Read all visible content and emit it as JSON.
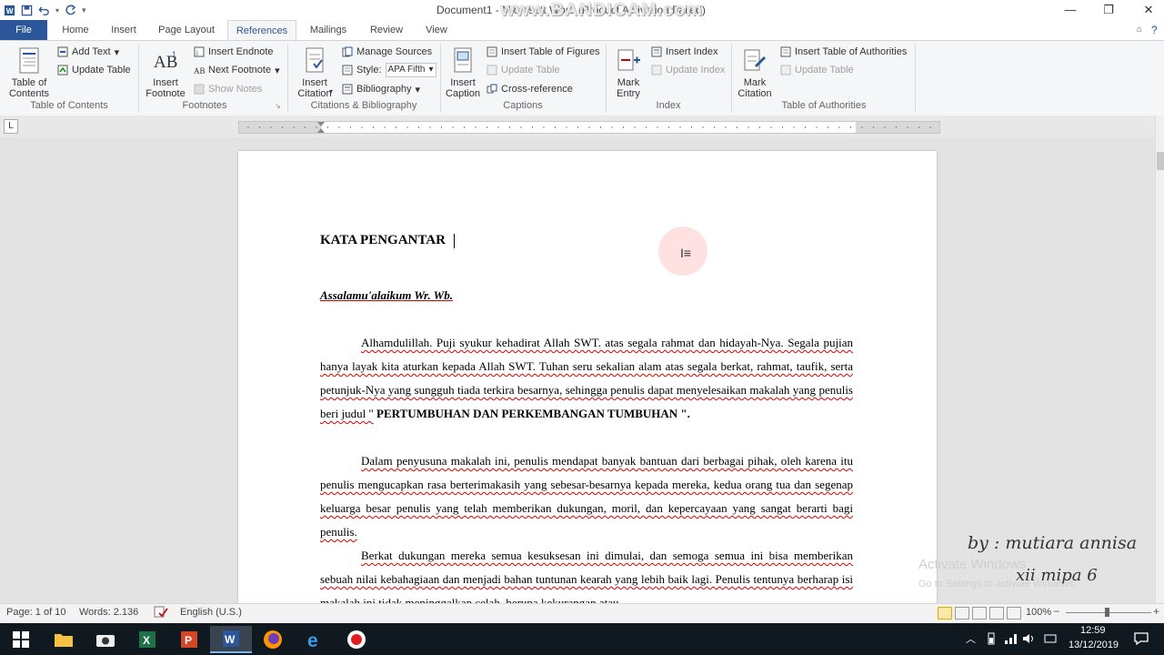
{
  "title_bar": {
    "document_title": "Document1 - Microsoft Word (Product Activation Failed)",
    "watermark": "www.BANDICAM.com",
    "minimize": "—",
    "restore": "❐",
    "close": "✕"
  },
  "tabs": [
    {
      "label": "File"
    },
    {
      "label": "Home"
    },
    {
      "label": "Insert"
    },
    {
      "label": "Page Layout"
    },
    {
      "label": "References"
    },
    {
      "label": "Mailings"
    },
    {
      "label": "Review"
    },
    {
      "label": "View"
    }
  ],
  "ribbon": {
    "toc": {
      "group": "Table of Contents",
      "big": "Table of\nContents",
      "add_text": "Add Text",
      "update_table": "Update Table"
    },
    "footnotes": {
      "group": "Footnotes",
      "big": "Insert\nFootnote",
      "insert_endnote": "Insert Endnote",
      "next_footnote": "Next Footnote",
      "show_notes": "Show Notes"
    },
    "citations": {
      "group": "Citations & Bibliography",
      "big": "Insert\nCitation",
      "manage_sources": "Manage Sources",
      "style_label": "Style:",
      "style_value": "APA Fifth",
      "bibliography": "Bibliography"
    },
    "captions": {
      "group": "Captions",
      "big": "Insert\nCaption",
      "insert_tof": "Insert Table of Figures",
      "update_table": "Update Table",
      "cross_reference": "Cross-reference"
    },
    "index": {
      "group": "Index",
      "big": "Mark\nEntry",
      "insert_index": "Insert Index",
      "update_index": "Update Index"
    },
    "toa": {
      "group": "Table of Authorities",
      "big": "Mark\nCitation",
      "insert_toa": "Insert Table of Authorities",
      "update_table": "Update Table"
    }
  },
  "document": {
    "heading": "KATA PENGANTAR",
    "greeting": "Assalamu'alaikum Wr. Wb.",
    "p1": "Alhamdulillah. Puji syukur kehadirat Allah SWT. atas segala rahmat dan hidayah-Nya. Segala pujian hanya layak kita aturkan kepada Allah SWT. Tuhan seru sekalian alam atas segala berkat, rahmat, taufik, serta petunjuk-Nya yang sungguh tiada terkira besarnya, sehingga penulis dapat menyelesaikan makalah yang penulis beri judul \"",
    "p1_bold": "PERTUMBUHAN DAN PERKEMBANGAN TUMBUHAN \".",
    "p2": "Dalam penyusuna makalah ini, penulis mendapat banyak bantuan dari berbagai pihak, oleh karena itu penulis mengucapkan rasa berterimakasih yang sebesar-besarnya kepada mereka, kedua orang tua dan segenap keluarga besar penulis yang telah memberikan dukungan, moril, dan kepercayaan yang sangat berarti bagi penulis.",
    "p3": "Berkat dukungan mereka semua kesuksesan ini dimulai, dan semoga semua ini bisa memberikan sebuah nilai kebahagiaan dan menjadi bahan tuntunan kearah yang lebih baik lagi. Penulis tentunya berharap isi makalah ini tidak meninggalkan celah, berupa kekurangan atau"
  },
  "overlay": {
    "activate": "Activate Windows",
    "activate_sub": "Go to Settings to activate Windows.",
    "by": "by : mutiara annisa",
    "class": "xii mipa 6"
  },
  "status": {
    "page": "Page: 1 of 10",
    "words": "Words: 2.136",
    "language": "English (U.S.)",
    "zoom": "100%"
  },
  "taskbar": {
    "time": "12:59",
    "date": "13/12/2019"
  },
  "colors": {
    "accent": "#2b579a",
    "taskbar": "#101820",
    "watermark": "#cfcfcf"
  }
}
